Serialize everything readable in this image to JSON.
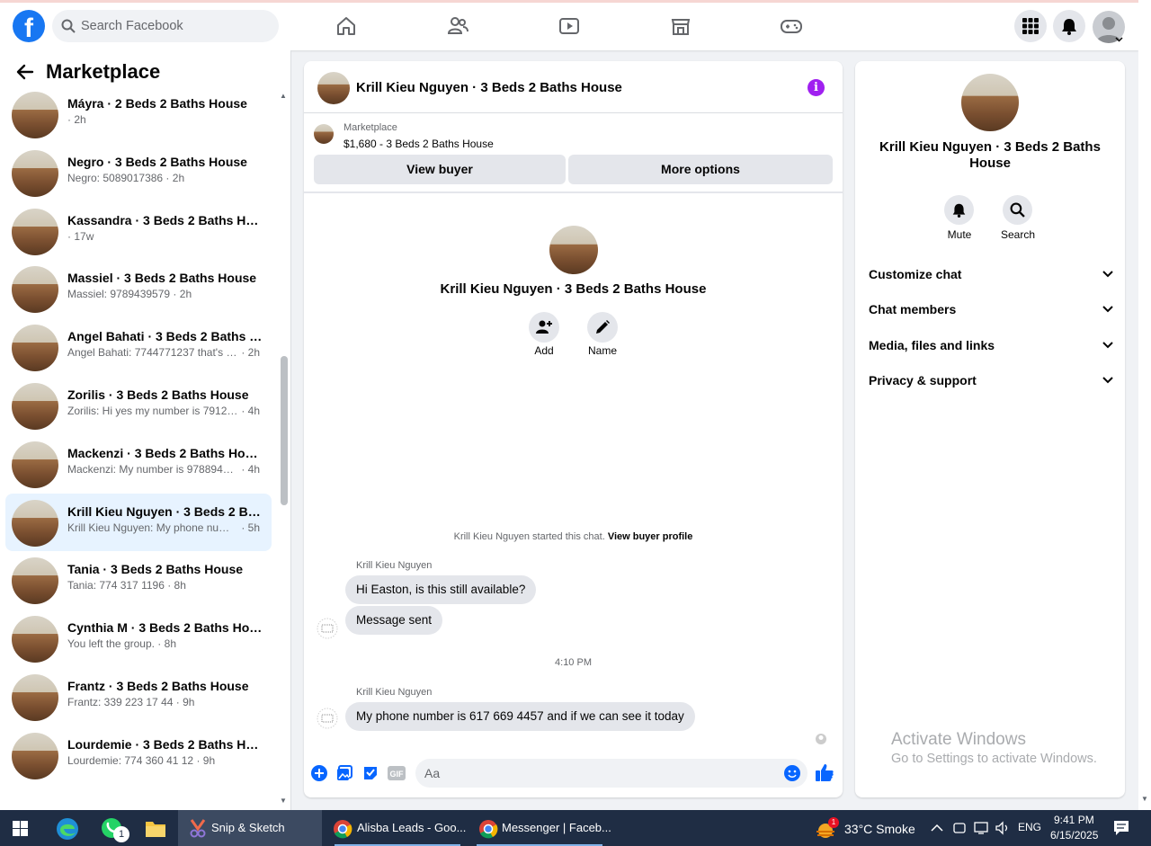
{
  "topbar": {
    "search_placeholder": "Search Facebook",
    "nav": [
      "home-icon",
      "friends-icon",
      "watch-icon",
      "marketplace-icon",
      "gaming-icon"
    ],
    "right": [
      "menu-grid-icon",
      "notifications-icon",
      "account-avatar"
    ]
  },
  "sidebar": {
    "title": "Marketplace",
    "conversations": [
      {
        "name": "Máyra · 2 Beds 2 Baths House",
        "preview": "",
        "time": "2h"
      },
      {
        "name": "Negro · 3 Beds 2 Baths House",
        "preview": "Negro: 5089017386",
        "time": "2h"
      },
      {
        "name": "Kassandra · 3 Beds 2 Baths House",
        "preview": "",
        "time": "17w"
      },
      {
        "name": "Massiel · 3 Beds 2 Baths House",
        "preview": "Massiel: 9789439579",
        "time": "2h"
      },
      {
        "name": "Angel Bahati · 3 Beds 2 Baths H...",
        "preview": "Angel Bahati: 7744771237 that's m...",
        "time": "2h"
      },
      {
        "name": "Zorilis · 3 Beds 2 Baths House",
        "preview": "Zorilis: Hi yes my number is 79121...",
        "time": "4h"
      },
      {
        "name": "Mackenzi · 3 Beds 2 Baths House",
        "preview": "Mackenzi: My number is 97889452...",
        "time": "4h"
      },
      {
        "name": "Krill Kieu Nguyen · 3 Beds 2 Bat...",
        "preview": "Krill Kieu Nguyen: My phone numb...",
        "time": "5h",
        "active": true
      },
      {
        "name": "Tania · 3 Beds 2 Baths House",
        "preview": "Tania: 774 317 1196",
        "time": "8h"
      },
      {
        "name": "Cynthia M · 3 Beds 2 Baths House",
        "preview": "You left the group.",
        "time": "8h"
      },
      {
        "name": "Frantz · 3 Beds 2 Baths House",
        "preview": "Frantz: 339 223 17 44",
        "time": "9h"
      },
      {
        "name": "Lourdemie · 3 Beds 2 Baths House",
        "preview": "Lourdemie: 774 360 41 12",
        "time": "9h"
      }
    ]
  },
  "chat": {
    "title": "Krill Kieu Nguyen · 3 Beds 2 Baths House",
    "marketplace_label": "Marketplace",
    "listing": "$1,680 - 3 Beds 2 Baths House",
    "view_buyer": "View buyer",
    "more_options": "More options",
    "profile_name": "Krill Kieu Nguyen · 3 Beds 2 Baths House",
    "add_label": "Add",
    "name_label": "Name",
    "system_note": "Krill Kieu Nguyen started this chat.",
    "system_link": "View buyer profile",
    "sender": "Krill Kieu Nguyen",
    "msg1": "Hi Easton, is this still available?",
    "msg2": "Message sent",
    "timestamp": "4:10 PM",
    "msg3": "My phone number is 617 669 4457 and if we can see it today",
    "composer_placeholder": "Aa"
  },
  "info": {
    "name": "Krill Kieu Nguyen · 3 Beds 2 Baths House",
    "mute": "Mute",
    "search": "Search",
    "sections": [
      "Customize chat",
      "Chat members",
      "Media, files and links",
      "Privacy & support"
    ],
    "watermark_title": "Activate Windows",
    "watermark_sub": "Go to Settings to activate Windows."
  },
  "taskbar": {
    "apps": [
      {
        "label": "Snip & Sketch",
        "active": true
      },
      {
        "label": "Alisba Leads - Goo...",
        "active": false
      },
      {
        "label": "Messenger | Faceb...",
        "active": false
      }
    ],
    "whatsapp_badge": "1",
    "weather_badge": "1",
    "weather": "33°C  Smoke",
    "lang": "ENG",
    "time": "9:41 PM",
    "date": "6/15/2025"
  },
  "colors": {
    "accent": "#1877f2",
    "info_purple": "#a020f0",
    "active_row": "#e7f3ff",
    "taskbar": "#1f2d44"
  }
}
